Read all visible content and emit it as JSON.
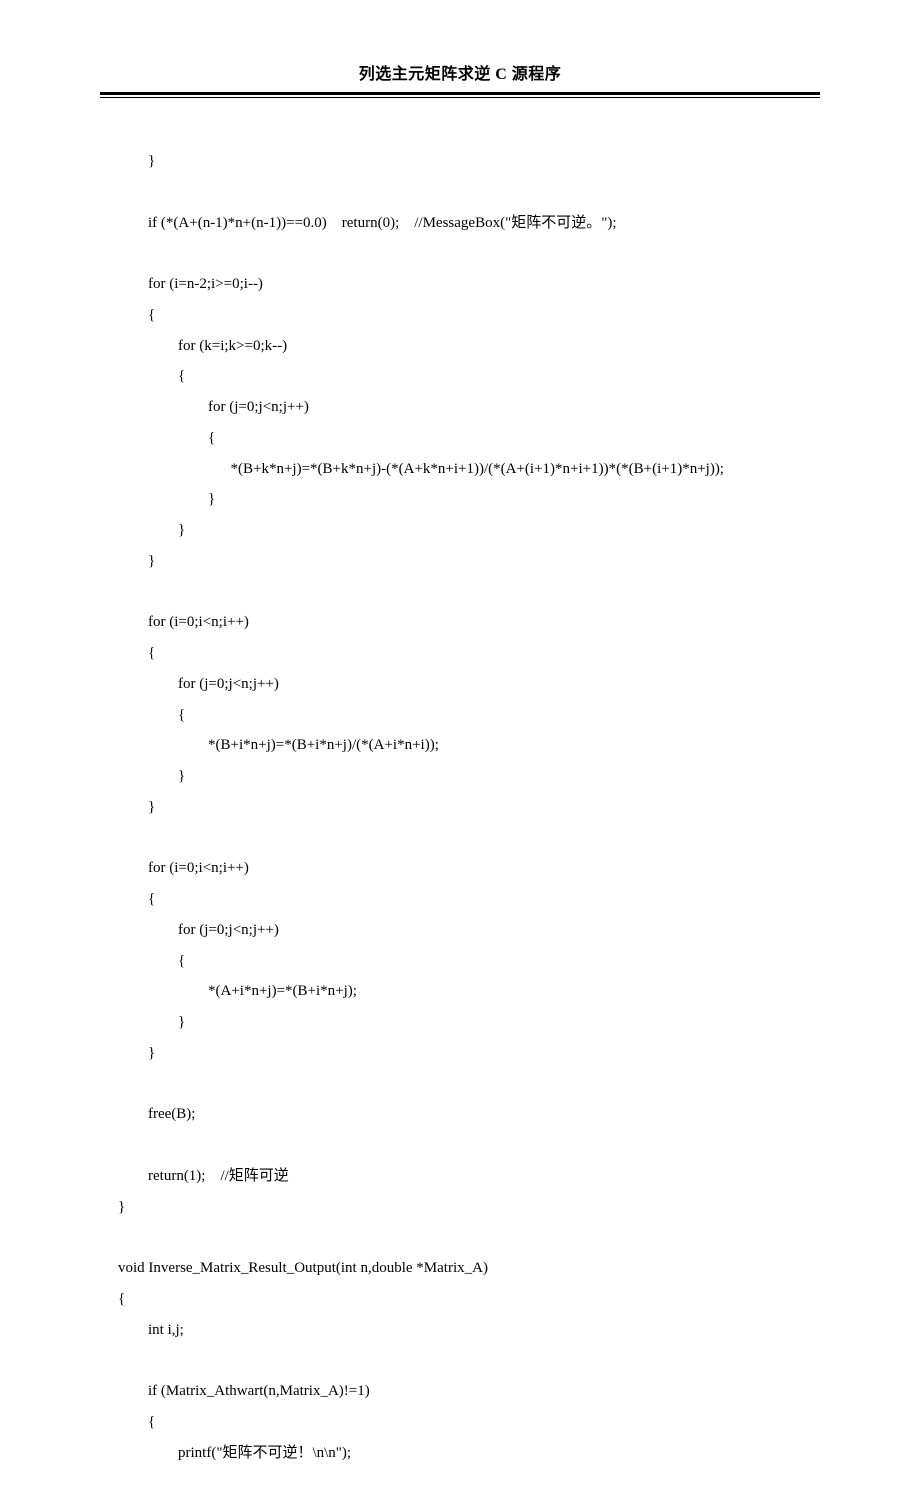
{
  "header": {
    "title": "列选主元矩阵求逆 C 源程序"
  },
  "code": {
    "lines": [
      "        }",
      "",
      "        if (*(A+(n-1)*n+(n-1))==0.0)    return(0);    //MessageBox(\"矩阵不可逆。\");",
      "",
      "        for (i=n-2;i>=0;i--)",
      "        {",
      "                for (k=i;k>=0;k--)",
      "                {",
      "                        for (j=0;j<n;j++)",
      "                        {",
      "                              *(B+k*n+j)=*(B+k*n+j)-(*(A+k*n+i+1))/(*(A+(i+1)*n+i+1))*(*(B+(i+1)*n+j));",
      "                        }",
      "                }",
      "        }",
      "",
      "        for (i=0;i<n;i++)",
      "        {",
      "                for (j=0;j<n;j++)",
      "                {",
      "                        *(B+i*n+j)=*(B+i*n+j)/(*(A+i*n+i));",
      "                }",
      "        }",
      "",
      "        for (i=0;i<n;i++)",
      "        {",
      "                for (j=0;j<n;j++)",
      "                {",
      "                        *(A+i*n+j)=*(B+i*n+j);",
      "                }",
      "        }",
      "",
      "        free(B);",
      "",
      "        return(1);    //矩阵可逆",
      "}",
      "",
      "void Inverse_Matrix_Result_Output(int n,double *Matrix_A)",
      "{",
      "        int i,j;",
      "",
      "        if (Matrix_Athwart(n,Matrix_A)!=1)",
      "        {",
      "                printf(\"矩阵不可逆！\\n\\n\");"
    ]
  }
}
